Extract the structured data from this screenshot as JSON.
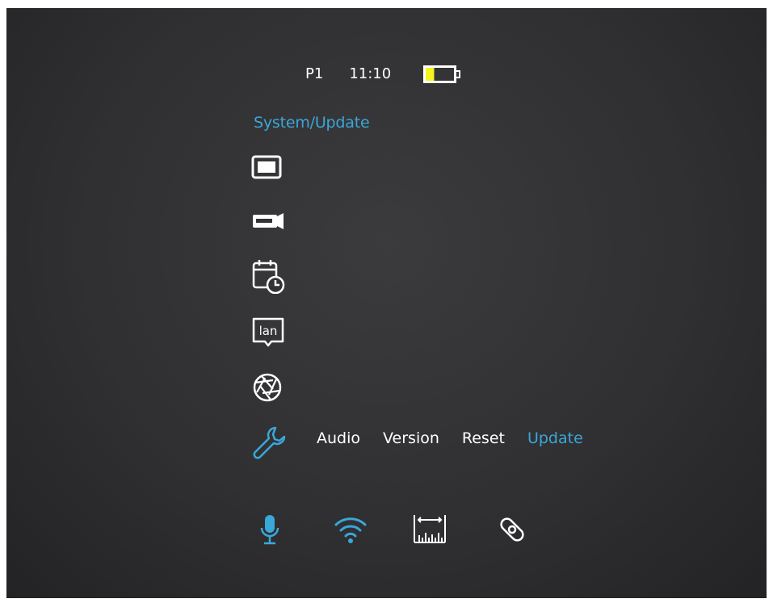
{
  "status": {
    "profile": "P1",
    "time": "11:10",
    "battery_level": 0.3
  },
  "breadcrumb": "System/Update",
  "menu": {
    "items": [
      {
        "icon": "display-icon"
      },
      {
        "icon": "camera-icon"
      },
      {
        "icon": "calendar-clock-icon"
      },
      {
        "icon": "language-icon",
        "label": "lan"
      },
      {
        "icon": "aperture-icon"
      },
      {
        "icon": "wrench-icon",
        "selected": true
      }
    ]
  },
  "submenu": {
    "items": [
      "Audio",
      "Version",
      "Reset",
      "Update"
    ],
    "selected": "Update"
  },
  "bottom_bar": {
    "icons": [
      "microphone-icon",
      "wifi-icon",
      "ruler-icon",
      "calibration-icon"
    ]
  },
  "colors": {
    "accent": "#3aa7d9",
    "battery_fill": "#f4f41e",
    "text": "#ffffff",
    "background": "#323234"
  }
}
